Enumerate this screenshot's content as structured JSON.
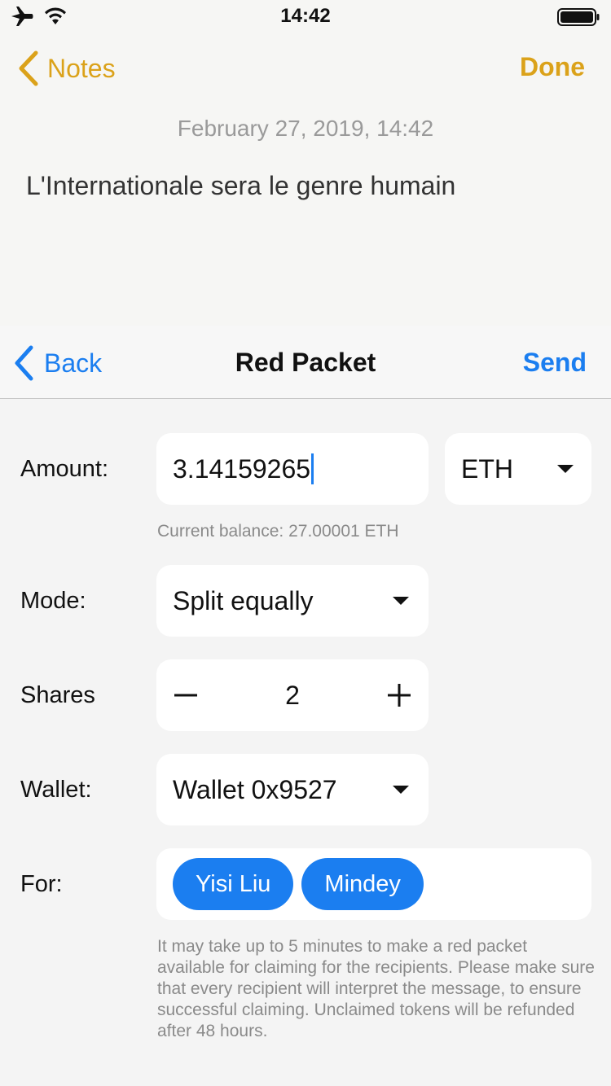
{
  "status_bar": {
    "time": "14:42",
    "icons": [
      "airplane-icon",
      "wifi-icon",
      "battery-icon"
    ]
  },
  "notes": {
    "back_label": "Notes",
    "done_label": "Done",
    "date": "February 27, 2019, 14:42",
    "body": "L'Internationale sera le genre humain",
    "accent_color": "#dba21a"
  },
  "red_packet": {
    "back_label": "Back",
    "title": "Red Packet",
    "send_label": "Send",
    "accent_color": "#1b7ef0"
  },
  "form": {
    "amount": {
      "label": "Amount:",
      "value": "3.14159265",
      "currency": "ETH",
      "balance_hint": "Current balance: 27.00001 ETH"
    },
    "mode": {
      "label": "Mode:",
      "value": "Split equally"
    },
    "shares": {
      "label": "Shares",
      "value": "2",
      "minus": "−",
      "plus": "+"
    },
    "wallet": {
      "label": "Wallet:",
      "value": "Wallet 0x9527"
    },
    "recipients": {
      "label": "For:",
      "chips": [
        "Yisi Liu",
        "Mindey"
      ]
    },
    "disclaimer": "It may take up to 5 minutes to make a red packet available for claiming for the recipients. Please make sure that every recipient will interpret the message, to ensure successful claiming. Unclaimed tokens will be refunded after 48 hours."
  }
}
